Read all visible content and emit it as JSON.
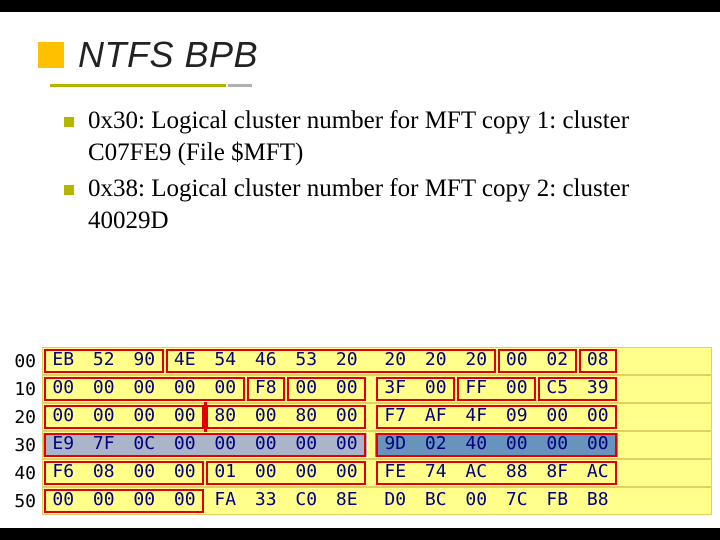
{
  "title": "NTFS BPB",
  "bullets": [
    "0x30: Logical cluster number for MFT copy 1: cluster C07FE9 (File $MFT)",
    "0x38: Logical cluster number for MFT copy 2: cluster 40029D"
  ],
  "hex": {
    "row_labels": [
      "00",
      "10",
      "20",
      "30",
      "40",
      "50"
    ],
    "rows": [
      [
        "EB",
        "52",
        "90",
        "4E",
        "54",
        "46",
        "53",
        "20",
        "20",
        "20",
        "20",
        "00",
        "02",
        "08"
      ],
      [
        "00",
        "00",
        "00",
        "00",
        "00",
        "F8",
        "00",
        "00",
        "3F",
        "00",
        "FF",
        "00",
        "C5",
        "39"
      ],
      [
        "00",
        "00",
        "00",
        "00",
        "80",
        "00",
        "80",
        "00",
        "F7",
        "AF",
        "4F",
        "09",
        "00",
        "00"
      ],
      [
        "E9",
        "7F",
        "0C",
        "00",
        "00",
        "00",
        "00",
        "00",
        "9D",
        "02",
        "40",
        "00",
        "00",
        "00"
      ],
      [
        "F6",
        "08",
        "00",
        "00",
        "01",
        "00",
        "00",
        "00",
        "FE",
        "74",
        "AC",
        "88",
        "8F",
        "AC"
      ],
      [
        "00",
        "00",
        "00",
        "00",
        "FA",
        "33",
        "C0",
        "8E",
        "D0",
        "BC",
        "00",
        "7C",
        "FB",
        "B8"
      ]
    ]
  },
  "highlights": [
    {
      "row": 0,
      "from": 0,
      "to": 2
    },
    {
      "row": 0,
      "from": 3,
      "to": 10
    },
    {
      "row": 0,
      "from": 11,
      "to": 12
    },
    {
      "row": 0,
      "from": 13,
      "to": 13
    },
    {
      "row": 1,
      "from": 0,
      "to": 4
    },
    {
      "row": 1,
      "from": 5,
      "to": 5
    },
    {
      "row": 1,
      "from": 6,
      "to": 7
    },
    {
      "row": 1,
      "from": 8,
      "to": 9
    },
    {
      "row": 1,
      "from": 10,
      "to": 11
    },
    {
      "row": 1,
      "from": 12,
      "to": 13
    },
    {
      "row": 2,
      "from": 0,
      "to": 3
    },
    {
      "row": 2,
      "from": 4,
      "to": 7
    },
    {
      "row": 2,
      "from": 8,
      "to": 13
    },
    {
      "row": 3,
      "from": 0,
      "to": 7
    },
    {
      "row": 3,
      "from": 8,
      "to": 13
    },
    {
      "row": 4,
      "from": 0,
      "to": 3
    },
    {
      "row": 4,
      "from": 4,
      "to": 7
    },
    {
      "row": 4,
      "from": 8,
      "to": 13
    },
    {
      "row": 5,
      "from": 0,
      "to": 3
    }
  ],
  "field_highlight": [
    {
      "row": 3,
      "from": 0,
      "to": 7,
      "class": "fill-a"
    },
    {
      "row": 3,
      "from": 8,
      "to": 13,
      "class": "fill-b"
    }
  ],
  "vsplit": {
    "row": 2,
    "after": 3
  }
}
